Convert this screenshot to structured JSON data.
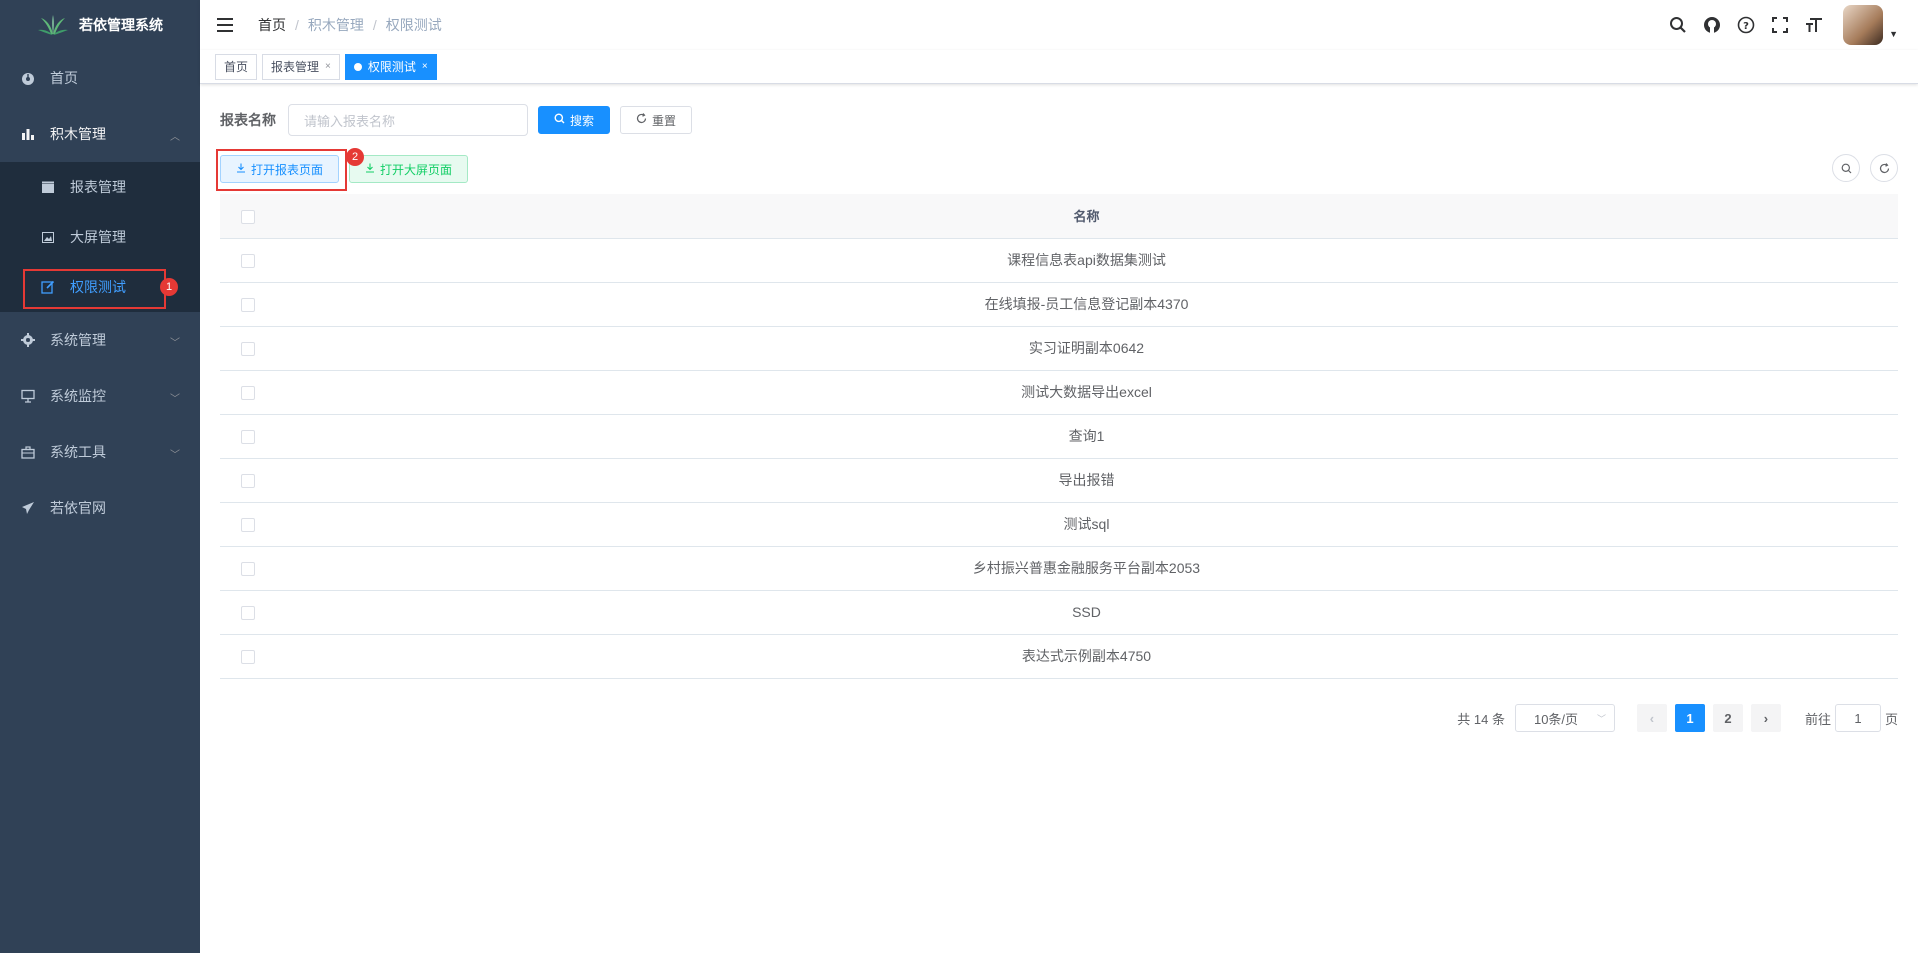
{
  "app": {
    "title": "若依管理系统"
  },
  "sidebar": {
    "items": [
      {
        "label": "首页",
        "icon": "dashboard-icon"
      },
      {
        "label": "积木管理",
        "icon": "chart-icon",
        "expanded": true,
        "children": [
          {
            "label": "报表管理",
            "icon": "clapperboard-icon"
          },
          {
            "label": "大屏管理",
            "icon": "image-icon"
          },
          {
            "label": "权限测试",
            "icon": "edit-icon",
            "active": true
          }
        ]
      },
      {
        "label": "系统管理",
        "icon": "gear-icon"
      },
      {
        "label": "系统监控",
        "icon": "monitor-icon"
      },
      {
        "label": "系统工具",
        "icon": "toolbox-icon"
      },
      {
        "label": "若依官网",
        "icon": "send-icon"
      }
    ]
  },
  "annotations": {
    "marker1": "1",
    "marker2": "2"
  },
  "breadcrumb": [
    "首页",
    "积木管理",
    "权限测试"
  ],
  "tags": [
    {
      "label": "首页"
    },
    {
      "label": "报表管理"
    },
    {
      "label": "权限测试",
      "active": true
    }
  ],
  "search": {
    "label": "报表名称",
    "placeholder": "请输入报表名称",
    "search_btn": "搜索",
    "reset_btn": "重置"
  },
  "toolbar": {
    "open_report": "打开报表页面",
    "open_screen": "打开大屏页面"
  },
  "table": {
    "header": "名称",
    "rows": [
      "课程信息表api数据集测试",
      "在线填报-员工信息登记副本4370",
      "实习证明副本0642",
      "测试大数据导出excel",
      "查询1",
      "导出报错",
      "测试sql",
      "乡村振兴普惠金融服务平台副本2053",
      "SSD",
      "表达式示例副本4750"
    ]
  },
  "pagination": {
    "total": "共 14 条",
    "page_size": "10条/页",
    "pages": [
      "1",
      "2"
    ],
    "current": "1",
    "goto_prefix": "前往",
    "goto_value": "1",
    "goto_suffix": "页"
  },
  "colors": {
    "sidebar_bg": "#304156",
    "primary": "#1890ff",
    "success": "#13ce66",
    "annotation_red": "#e53935"
  }
}
